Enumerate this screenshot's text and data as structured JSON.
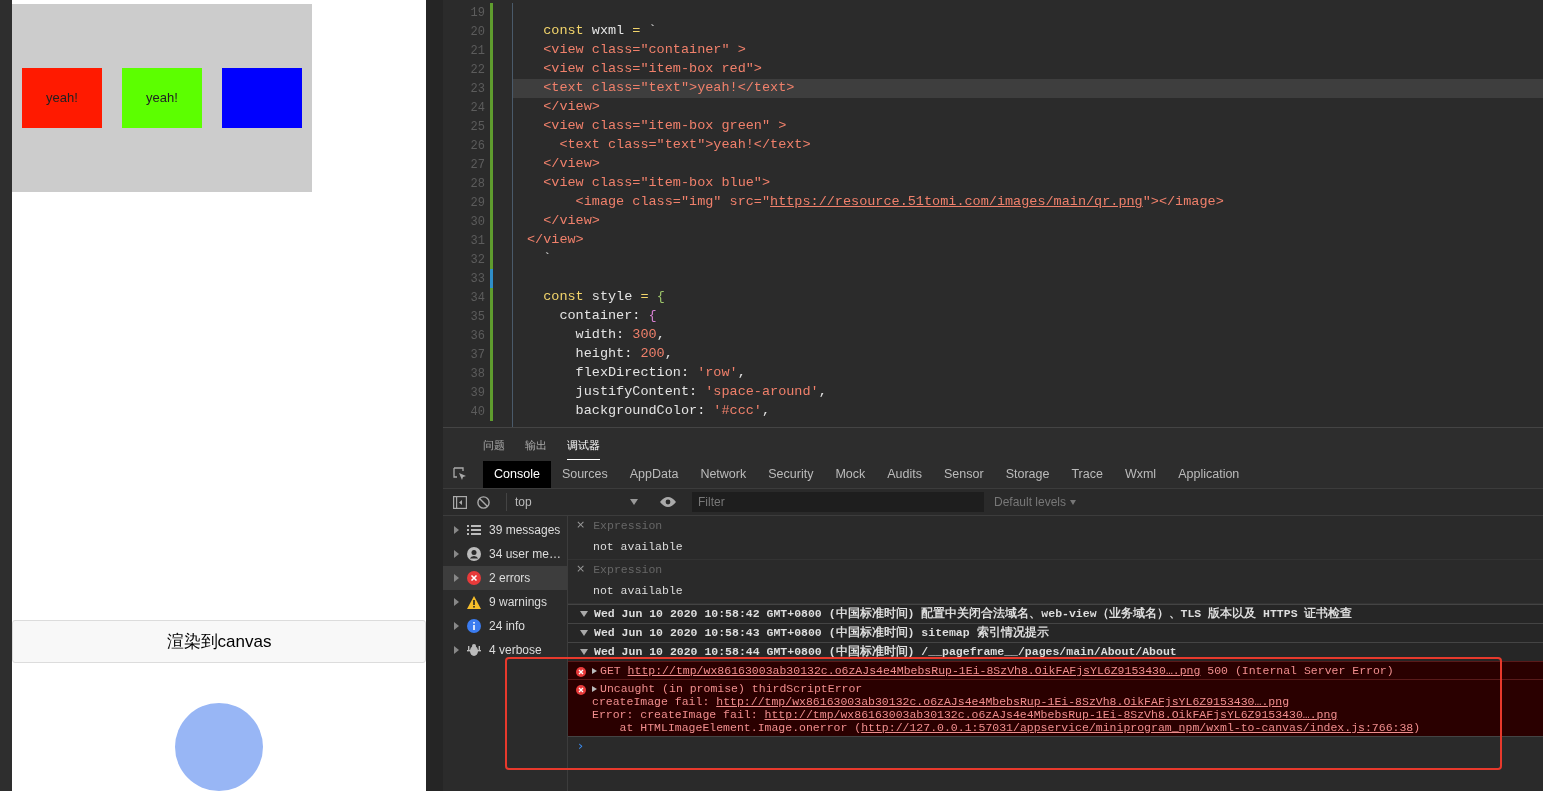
{
  "simulator": {
    "boxes": [
      {
        "color": "#ff1a00",
        "text": "yeah!"
      },
      {
        "color": "#5cff00",
        "text": "yeah!"
      },
      {
        "color": "#0000ff"
      }
    ],
    "button": "渲染到canvas"
  },
  "editor": {
    "lines": [
      {
        "number": "19",
        "current": false,
        "color": "#5f9c2e"
      },
      {
        "number": "20",
        "current": false,
        "color": "#5f9c2e",
        "tokens": [
          {
            "kind": "kw",
            "t": "  const"
          },
          {
            "kind": "tx",
            "t": " wxml "
          },
          {
            "kind": "kw",
            "t": "="
          },
          {
            "kind": "tx",
            "t": " `"
          }
        ]
      },
      {
        "number": "21",
        "current": false,
        "color": "#5f9c2e",
        "tokens": [
          {
            "kind": "tag",
            "t": "  <view class=\"container\" >"
          }
        ]
      },
      {
        "number": "22",
        "current": false,
        "color": "#5f9c2e",
        "tokens": [
          {
            "kind": "tag",
            "t": "  <view class=\"item-box red\">"
          }
        ]
      },
      {
        "number": "23",
        "current": true,
        "color": "#5f9c2e",
        "tokens": [
          {
            "kind": "tag",
            "t": "  <text class=\"text\">yeah!</text>"
          }
        ]
      },
      {
        "number": "24",
        "current": false,
        "color": "#5f9c2e",
        "tokens": [
          {
            "kind": "tag",
            "t": "  </view>"
          }
        ]
      },
      {
        "number": "25",
        "current": false,
        "color": "#5f9c2e",
        "tokens": [
          {
            "kind": "tag",
            "t": "  <view class=\"item-box green\" >"
          }
        ]
      },
      {
        "number": "26",
        "current": false,
        "color": "#5f9c2e",
        "tokens": [
          {
            "kind": "tag",
            "t": "    <text class=\"text\">yeah!</text>"
          }
        ]
      },
      {
        "number": "27",
        "current": false,
        "color": "#5f9c2e",
        "tokens": [
          {
            "kind": "tag",
            "t": "  </view>"
          }
        ]
      },
      {
        "number": "28",
        "current": false,
        "color": "#5f9c2e",
        "tokens": [
          {
            "kind": "tag",
            "t": "  <view class=\"item-box blue\">"
          }
        ]
      },
      {
        "number": "29",
        "current": false,
        "color": "#5f9c2e",
        "tokens": [
          {
            "kind": "tag",
            "t": "      <image class=\"img\" src=\""
          },
          {
            "kind": "link",
            "t": "https://resource.51tomi.com/images/main/qr.png"
          },
          {
            "kind": "tag",
            "t": "\"></image>"
          }
        ]
      },
      {
        "number": "30",
        "current": false,
        "color": "#5f9c2e",
        "tokens": [
          {
            "kind": "tag",
            "t": "  </view>"
          }
        ]
      },
      {
        "number": "31",
        "current": false,
        "color": "#5f9c2e",
        "tokens": [
          {
            "kind": "tag",
            "t": "</view>"
          }
        ]
      },
      {
        "number": "32",
        "current": false,
        "color": "#5f9c2e",
        "tokens": [
          {
            "kind": "tx",
            "t": "  `"
          }
        ]
      },
      {
        "number": "33",
        "current": false,
        "color": "#2f8ec9"
      },
      {
        "number": "34",
        "current": false,
        "color": "#5f9c2e",
        "tokens": [
          {
            "kind": "kw",
            "t": "  const"
          },
          {
            "kind": "tx",
            "t": " style "
          },
          {
            "kind": "kw",
            "t": "="
          },
          {
            "kind": "br1",
            "t": " {"
          }
        ]
      },
      {
        "number": "35",
        "current": false,
        "color": "#5f9c2e",
        "tokens": [
          {
            "kind": "tx",
            "t": "    container: "
          },
          {
            "kind": "br2",
            "t": "{"
          }
        ]
      },
      {
        "number": "36",
        "current": false,
        "color": "#5f9c2e",
        "tokens": [
          {
            "kind": "tx",
            "t": "      width: "
          },
          {
            "kind": "num",
            "t": "300"
          },
          {
            "kind": "tx",
            "t": ","
          }
        ]
      },
      {
        "number": "37",
        "current": false,
        "color": "#5f9c2e",
        "tokens": [
          {
            "kind": "tx",
            "t": "      height: "
          },
          {
            "kind": "num",
            "t": "200"
          },
          {
            "kind": "tx",
            "t": ","
          }
        ]
      },
      {
        "number": "38",
        "current": false,
        "color": "#5f9c2e",
        "tokens": [
          {
            "kind": "tx",
            "t": "      flexDirection: "
          },
          {
            "kind": "num",
            "t": "'row'"
          },
          {
            "kind": "tx",
            "t": ","
          }
        ]
      },
      {
        "number": "39",
        "current": false,
        "color": "#5f9c2e",
        "tokens": [
          {
            "kind": "tx",
            "t": "      justifyContent: "
          },
          {
            "kind": "num",
            "t": "'space-around'"
          },
          {
            "kind": "tx",
            "t": ","
          }
        ]
      },
      {
        "number": "40",
        "current": false,
        "color": "#5f9c2e",
        "tokens": [
          {
            "kind": "tx",
            "t": "      backgroundColor: "
          },
          {
            "kind": "num",
            "t": "'#ccc'"
          },
          {
            "kind": "tx",
            "t": ","
          }
        ]
      }
    ]
  },
  "panel_tabs": [
    {
      "label": "问题",
      "selected": false
    },
    {
      "label": "输出",
      "selected": false
    },
    {
      "label": "调试器",
      "selected": true
    }
  ],
  "devtools_tabs": [
    {
      "label": "Console",
      "selected": true
    },
    {
      "label": "Sources",
      "selected": false
    },
    {
      "label": "AppData",
      "selected": false
    },
    {
      "label": "Network",
      "selected": false
    },
    {
      "label": "Security",
      "selected": false
    },
    {
      "label": "Mock",
      "selected": false
    },
    {
      "label": "Audits",
      "selected": false
    },
    {
      "label": "Sensor",
      "selected": false
    },
    {
      "label": "Storage",
      "selected": false
    },
    {
      "label": "Trace",
      "selected": false
    },
    {
      "label": "Wxml",
      "selected": false
    },
    {
      "label": "Application",
      "selected": false
    }
  ],
  "toolbar": {
    "context": "top",
    "filter_placeholder": "Filter",
    "levels": "Default levels"
  },
  "sidebar": [
    {
      "kind": "messages",
      "label": "39 messages",
      "selected": false
    },
    {
      "kind": "user",
      "label": "34 user me…",
      "selected": false
    },
    {
      "kind": "errors",
      "label": "2 errors",
      "selected": true
    },
    {
      "kind": "warnings",
      "label": "9 warnings",
      "selected": false
    },
    {
      "kind": "info",
      "label": "24 info",
      "selected": false
    },
    {
      "kind": "verbose",
      "label": "4 verbose",
      "selected": false
    }
  ],
  "expressions": [
    {
      "close": "×",
      "label": "Expression",
      "value": "not available"
    },
    {
      "close": "×",
      "label": "Expression",
      "value": "not available"
    }
  ],
  "logs": [
    {
      "kind": "group",
      "expanded": true,
      "lines": [
        [
          {
            "kind": "tx",
            "t": "Wed Jun 10 2020 10:58:42 GMT+0800 (中国标准时间) 配置中关闭合法域名、web-view（业务域名）、TLS 版本以及 HTTPS 证书检查"
          }
        ]
      ]
    },
    {
      "kind": "group",
      "expanded": true,
      "lines": [
        [
          {
            "kind": "tx",
            "t": "Wed Jun 10 2020 10:58:43 GMT+0800 (中国标准时间) sitemap 索引情况提示"
          }
        ]
      ]
    },
    {
      "kind": "group",
      "expanded": true,
      "lines": [
        [
          {
            "kind": "tx",
            "t": "Wed Jun 10 2020 10:58:44 GMT+0800 (中国标准时间) /__pageframe__/pages/main/About/About"
          }
        ]
      ]
    },
    {
      "kind": "error",
      "expanded": false,
      "lines": [
        [
          {
            "kind": "tx",
            "t": "GET "
          },
          {
            "kind": "link",
            "t": "http://tmp/wx86163003ab30132c.o6zAJs4e4MbebsRup-1Ei-8SzVh8.OikFAFjsYL6Z9153430….png"
          },
          {
            "kind": "tx",
            "t": " 500 (Internal Server Error)"
          }
        ]
      ]
    },
    {
      "kind": "error",
      "expanded": false,
      "lines": [
        [
          {
            "kind": "tx",
            "t": "Uncaught (in promise) thirdScriptError"
          }
        ],
        [
          {
            "kind": "tx",
            "t": "createImage fail: "
          },
          {
            "kind": "link",
            "t": "http://tmp/wx86163003ab30132c.o6zAJs4e4MbebsRup-1Ei-8SzVh8.OikFAFjsYL6Z9153430….png"
          }
        ],
        [
          {
            "kind": "tx",
            "t": "Error: createImage fail: "
          },
          {
            "kind": "link",
            "t": "http://tmp/wx86163003ab30132c.o6zAJs4e4MbebsRup-1Ei-8SzVh8.OikFAFjsYL6Z9153430….png"
          }
        ],
        [
          {
            "kind": "tx",
            "t": "    at HTMLImageElement.Image.onerror ("
          },
          {
            "kind": "link",
            "t": "http://127.0.0.1:57031/appservice/miniprogram_npm/wxml-to-canvas/index.js:766:38"
          },
          {
            "kind": "tx",
            "t": ")"
          }
        ]
      ]
    }
  ],
  "prompt": "›"
}
